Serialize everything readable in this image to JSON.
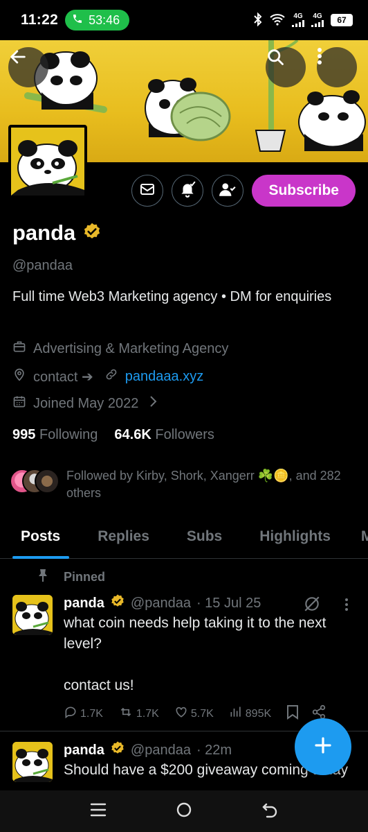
{
  "status_bar": {
    "time": "11:22",
    "call_timer": "53:46",
    "network_1": "4G",
    "network_2": "4G",
    "battery": "67"
  },
  "profile": {
    "display_name": "panda",
    "handle": "@pandaa",
    "bio": "Full time Web3 Marketing agency • DM for enquiries",
    "category": "Advertising & Marketing Agency",
    "location": "contact ➔",
    "website": "pandaaa.xyz",
    "joined": "Joined May 2022",
    "following_count": "995",
    "following_label": "Following",
    "followers_count": "64.6K",
    "followers_label": "Followers",
    "followed_by": "Followed by Kirby, Shork, Xangerr ☘️🪙, and 282 others",
    "subscribe_label": "Subscribe",
    "verified_color": "#e8b829",
    "subscribe_color": "#c936c9"
  },
  "tabs": [
    "Posts",
    "Replies",
    "Subs",
    "Highlights",
    "M"
  ],
  "pinned_label": "Pinned",
  "posts": [
    {
      "name": "panda",
      "handle": "@pandaa",
      "time": "· 15 Jul 25",
      "text": "what coin needs help taking it to the next level?\n\ncontact us!",
      "replies": "1.7K",
      "reposts": "1.7K",
      "likes": "5.7K",
      "views": "895K"
    },
    {
      "name": "panda",
      "handle": "@pandaa",
      "time": "· 22m",
      "text": "Should have a $200 giveaway coming today"
    }
  ],
  "accent_color": "#1d9bf0"
}
